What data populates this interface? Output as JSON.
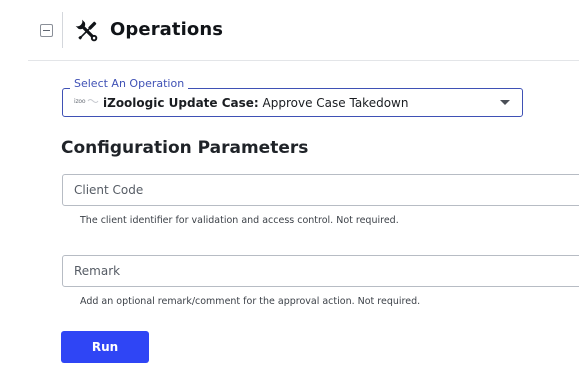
{
  "header": {
    "collapse_icon": "minus-square-icon",
    "tools_icon": "wrench-screwdriver-icon",
    "title": "Operations"
  },
  "operation_select": {
    "legend": "Select An Operation",
    "app_logo_text": "izoo",
    "app_name": "iZoologic Update Case",
    "separator": ":",
    "action_name": " Approve Case Takedown",
    "dropdown_icon": "caret-down-icon"
  },
  "config": {
    "title": "Configuration Parameters",
    "fields": [
      {
        "placeholder": "Client Code",
        "value": "",
        "help": "The client identifier for validation and access control. Not required."
      },
      {
        "placeholder": "Remark",
        "value": "",
        "help": "Add an optional remark/comment for the approval action. Not required."
      }
    ]
  },
  "actions": {
    "run_label": "Run"
  },
  "colors": {
    "accent": "#3f51b5",
    "run_button": "#2f45f5"
  }
}
